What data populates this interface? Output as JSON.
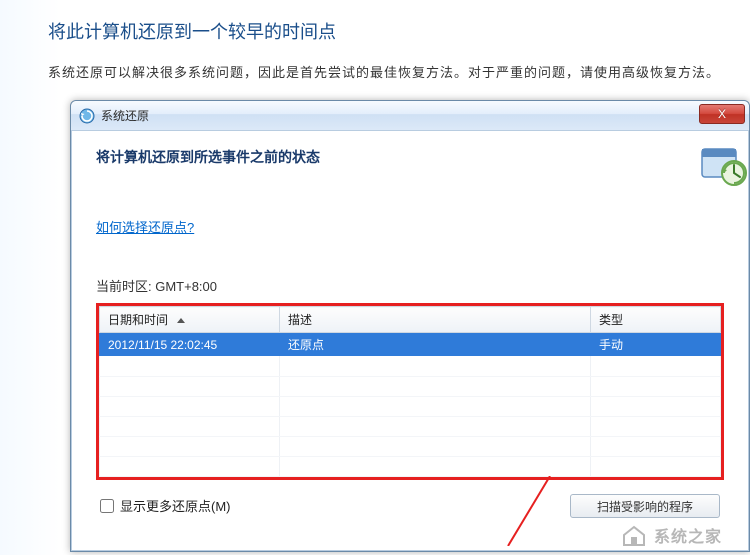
{
  "page": {
    "heading": "将此计算机还原到一个较早的时间点",
    "description": "系统还原可以解决很多系统问题，因此是首先尝试的最佳恢复方法。对于严重的问题，请使用高级恢复方法。"
  },
  "window": {
    "title": "系统还原",
    "close_label": "X",
    "body_title": "将计算机还原到所选事件之前的状态",
    "help_link": "如何选择还原点?",
    "timezone_label": "当前时区: GMT+8:00",
    "columns": {
      "date": "日期和时间",
      "desc": "描述",
      "type": "类型"
    },
    "rows": [
      {
        "date": "2012/11/15 22:02:45",
        "desc": "还原点",
        "type": "手动",
        "selected": true
      }
    ],
    "show_more_label": "显示更多还原点(M)",
    "scan_button": "扫描受影响的程序"
  },
  "watermark": {
    "text": "系统之家"
  }
}
